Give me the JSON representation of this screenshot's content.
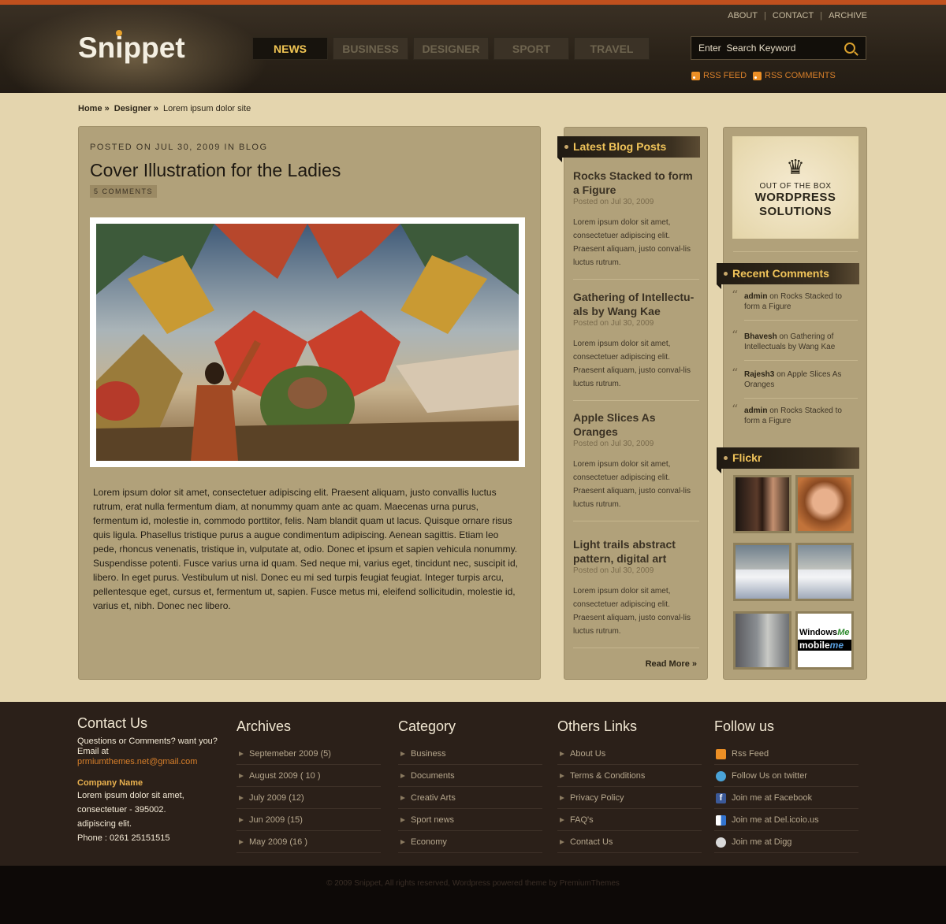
{
  "header": {
    "logo": "Snippet",
    "top_links": [
      "ABOUT",
      "CONTACT",
      "ARCHIVE"
    ],
    "nav": [
      "NEWS",
      "BUSINESS",
      "DESIGNER",
      "SPORT",
      "TRAVEL"
    ],
    "search_placeholder": "Enter  Search Keyword",
    "rss_feed": "RSS FEED",
    "rss_comments": "RSS COMMENTS"
  },
  "breadcrumb": {
    "home": "Home »",
    "designer": "Designer »",
    "current": "Lorem ipsum dolor site"
  },
  "post": {
    "meta": "POSTED ON JUL 30, 2009 IN BLOG",
    "title": "Cover Illustration for the Ladies",
    "comments": "5 COMMENTS",
    "body": "Lorem ipsum dolor sit amet, consectetuer adipiscing elit. Praesent aliquam,  justo convallis luctus rutrum, erat nulla fermentum diam, at nonummy quam  ante ac quam. Maecenas urna purus, fermentum id, molestie in, commodo  porttitor, felis. Nam blandit quam ut lacus. Quisque ornare risus quis  ligula. Phasellus tristique purus a augue condimentum adipiscing. Aenean  sagittis. Etiam leo pede, rhoncus venenatis, tristique in, vulputate at,  odio. Donec et ipsum et sapien vehicula nonummy. Suspendisse potenti. Fusce  varius urna id quam. Sed neque mi, varius eget, tincidunt nec, suscipit id,  libero. In eget purus. Vestibulum ut nisl. Donec eu mi sed turpis feugiat feugiat. Integer turpis arcu, pellentesque eget, cursus et, fermentum ut,  sapien. Fusce metus mi, eleifend sollicitudin, molestie id, varius et, nibh.  Donec nec libero."
  },
  "blog": {
    "heading": "Latest Blog Posts",
    "posts": [
      {
        "title": "Rocks Stacked to form a Figure",
        "date": "Posted on Jul 30, 2009",
        "excerpt": "Lorem ipsum dolor sit amet, consectetuer adipiscing elit. Praesent aliquam,  justo conval-lis luctus rutrum."
      },
      {
        "title": "Gathering of Intellectu-als by Wang Kae",
        "date": "Posted on Jul 30, 2009",
        "excerpt": "Lorem ipsum dolor sit amet, consectetuer adipiscing elit. Praesent aliquam,  justo conval-lis luctus rutrum."
      },
      {
        "title": "Apple Slices As Oranges",
        "date": "Posted on Jul 30, 2009",
        "excerpt": "Lorem ipsum dolor sit amet, consectetuer adipiscing elit. Praesent aliquam,  justo conval-lis luctus rutrum."
      },
      {
        "title": "Light trails abstract pattern, digital art",
        "date": "Posted on Jul 30, 2009",
        "excerpt": "Lorem ipsum dolor sit amet, consectetuer adipiscing elit. Praesent aliquam,  justo conval-lis luctus rutrum."
      }
    ],
    "read_more": "Read More »"
  },
  "sidebar": {
    "ad": {
      "line1": "OUT OF THE BOX",
      "line2": "WORDPRESS",
      "line3": "SOLUTIONS"
    },
    "recent_heading": "Recent Comments",
    "comments": [
      {
        "author": "admin",
        "on": " on Rocks Stacked to form a Figure"
      },
      {
        "author": "Bhavesh",
        "on": " on Gathering of Intellectuals by Wang Kae"
      },
      {
        "author": "Rajesh3",
        "on": " on Apple Slices As Oranges"
      },
      {
        "author": "admin",
        "on": " on Rocks Stacked to form a Figure"
      }
    ],
    "flickr_heading": "Flickr",
    "flickr_text": {
      "windows": "Windows",
      "me": "Me",
      "mobile": "mobile",
      "me2": "me"
    }
  },
  "footer": {
    "contact": {
      "heading": "Contact Us",
      "line1": "Questions or Comments? want you?",
      "line2": "Email  at",
      "email": "prmiumthemes.net@gmail.com",
      "company_label": "Company Name",
      "addr1": "Lorem ipsum dolor sit amet,",
      "addr2": " consectetuer - 395002.",
      "addr3": "adipiscing elit.",
      "phone": "Phone : 0261 25151515"
    },
    "archives": {
      "heading": "Archives",
      "items": [
        "Septemeber 2009   (5)",
        "August 2009 ( 10 )",
        "July 2009 (12)",
        "Jun 2009 (15)",
        "May 2009 (16 )"
      ]
    },
    "category": {
      "heading": "Category",
      "items": [
        "Business",
        "Documents",
        "Creativ Arts",
        "Sport news",
        "Economy"
      ]
    },
    "others": {
      "heading": "Others Links",
      "items": [
        "About Us",
        "Terms & Conditions",
        "Privacy Policy",
        "FAQ's",
        "Contact Us"
      ]
    },
    "follow": {
      "heading": "Follow us",
      "items": [
        "Rss Feed",
        "Follow Us on twitter",
        "Join me at Facebook",
        "Join me at Del.icoio.us",
        "Join me at Digg"
      ]
    },
    "copyright": "© 2009 Snippet, All rights reserved,  Wordpress powered theme by PremiumThemes"
  },
  "colors": {
    "accent": "#f2c654",
    "link_orange": "#d77f2a",
    "header_stripe": "#c0501e"
  }
}
